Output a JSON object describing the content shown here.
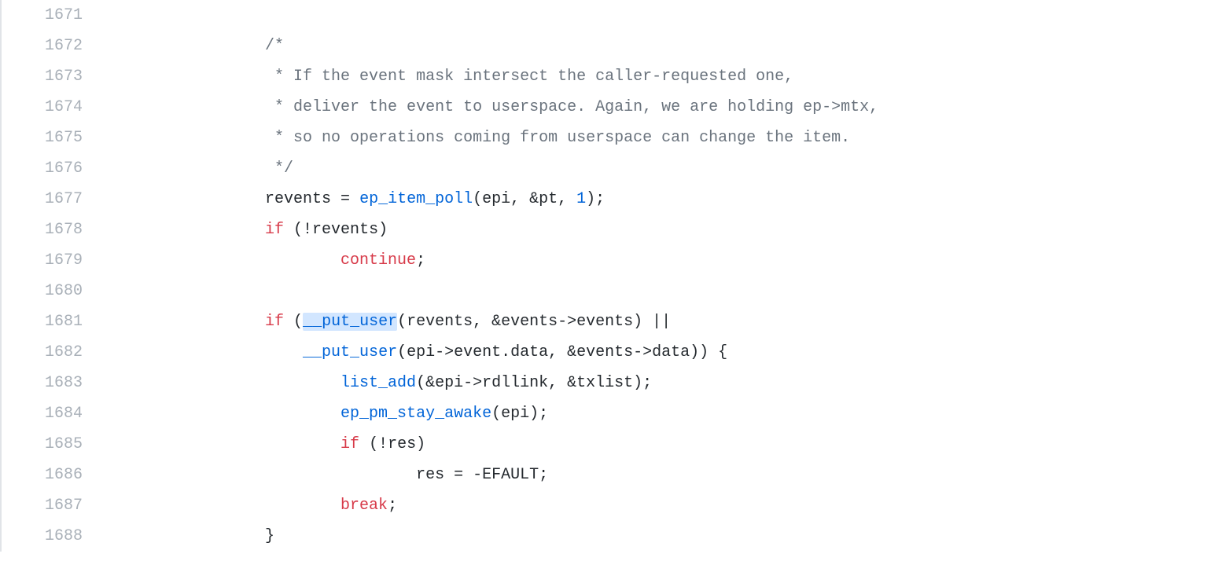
{
  "code": {
    "lines": [
      {
        "num": "1671",
        "indent": "",
        "tokens": []
      },
      {
        "num": "1672",
        "indent": "                /*",
        "tokens": [],
        "plain_comment": true
      },
      {
        "num": "1673",
        "indent": "                 * If the event mask intersect the caller-requested one,",
        "tokens": [],
        "plain_comment": true
      },
      {
        "num": "1674",
        "indent": "                 * deliver the event to userspace. Again, we are holding ep->mtx,",
        "tokens": [],
        "plain_comment": true
      },
      {
        "num": "1675",
        "indent": "                 * so no operations coming from userspace can change the item.",
        "tokens": [],
        "plain_comment": true
      },
      {
        "num": "1676",
        "indent": "                 */",
        "tokens": [],
        "plain_comment": true
      },
      {
        "num": "1677",
        "indent": "                ",
        "tokens": [
          {
            "t": "revents = ",
            "cls": "id"
          },
          {
            "t": "ep_item_poll",
            "cls": "fn"
          },
          {
            "t": "(epi, &pt, ",
            "cls": "id"
          },
          {
            "t": "1",
            "cls": "n"
          },
          {
            "t": ");",
            "cls": "id"
          }
        ]
      },
      {
        "num": "1678",
        "indent": "                ",
        "tokens": [
          {
            "t": "if",
            "cls": "k"
          },
          {
            "t": " (!revents)",
            "cls": "id"
          }
        ]
      },
      {
        "num": "1679",
        "indent": "                        ",
        "tokens": [
          {
            "t": "continue",
            "cls": "k"
          },
          {
            "t": ";",
            "cls": "id"
          }
        ]
      },
      {
        "num": "1680",
        "indent": "",
        "tokens": []
      },
      {
        "num": "1681",
        "indent": "                ",
        "tokens": [
          {
            "t": "if",
            "cls": "k"
          },
          {
            "t": " (",
            "cls": "id"
          },
          {
            "t": "__put_user",
            "cls": "fn",
            "highlight": true
          },
          {
            "t": "(revents, &events->events) ||",
            "cls": "id"
          }
        ]
      },
      {
        "num": "1682",
        "indent": "                    ",
        "tokens": [
          {
            "t": "__put_user",
            "cls": "fn"
          },
          {
            "t": "(epi->event.data, &events->data)) {",
            "cls": "id"
          }
        ]
      },
      {
        "num": "1683",
        "indent": "                        ",
        "tokens": [
          {
            "t": "list_add",
            "cls": "fn"
          },
          {
            "t": "(&epi->rdllink, &txlist);",
            "cls": "id"
          }
        ]
      },
      {
        "num": "1684",
        "indent": "                        ",
        "tokens": [
          {
            "t": "ep_pm_stay_awake",
            "cls": "fn"
          },
          {
            "t": "(epi);",
            "cls": "id"
          }
        ]
      },
      {
        "num": "1685",
        "indent": "                        ",
        "tokens": [
          {
            "t": "if",
            "cls": "k"
          },
          {
            "t": " (!res)",
            "cls": "id"
          }
        ]
      },
      {
        "num": "1686",
        "indent": "                                ",
        "tokens": [
          {
            "t": "res = -EFAULT;",
            "cls": "id"
          }
        ]
      },
      {
        "num": "1687",
        "indent": "                        ",
        "tokens": [
          {
            "t": "break",
            "cls": "k"
          },
          {
            "t": ";",
            "cls": "id"
          }
        ]
      },
      {
        "num": "1688",
        "indent": "                ",
        "tokens": [
          {
            "t": "}",
            "cls": "id"
          }
        ]
      }
    ]
  }
}
